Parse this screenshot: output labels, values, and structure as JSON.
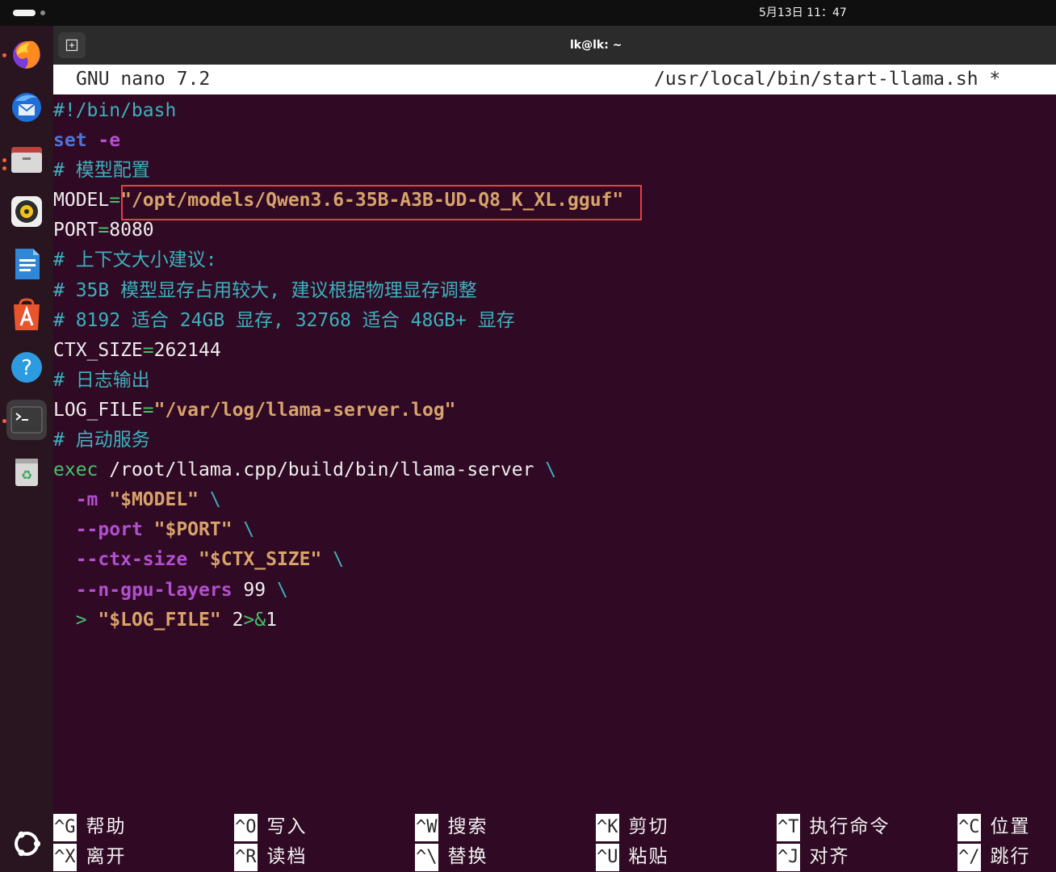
{
  "topbar": {
    "clock": "5月13日  11：47"
  },
  "window": {
    "title": "lk@lk: ~"
  },
  "nano": {
    "version": "GNU nano 7.2",
    "filename": "/usr/local/bin/start-llama.sh *"
  },
  "code": {
    "l1": "#!/bin/bash",
    "l2_kw": "set",
    "l2_flag": " -e",
    "l3": "# 模型配置",
    "l4_var": "MODEL",
    "l4_eq": "=",
    "l4_val": "\"/opt/models/Qwen3.6-35B-A3B-UD-Q8_K_XL.gguf\"",
    "l5_var": "PORT",
    "l5_eq": "=",
    "l5_val": "8080",
    "l6": "# 上下文大小建议:",
    "l7": "# 35B 模型显存占用较大, 建议根据物理显存调整",
    "l8": "# 8192 适合 24GB 显存, 32768 适合 48GB+ 显存",
    "l9_var": "CTX_SIZE",
    "l9_eq": "=",
    "l9_val": "262144",
    "l10": "# 日志输出",
    "l11_var": "LOG_FILE",
    "l11_eq": "=",
    "l11_val": "\"/var/log/llama-server.log\"",
    "l12": "# 启动服务",
    "l13_kw": "exec",
    "l13_path": " /root/llama.cpp/build/bin/llama-server ",
    "l13_bs": "\\",
    "l14_flag": "-m",
    "l14_val": " \"$MODEL\" ",
    "l14_bs": "\\",
    "l15_flag": "--port",
    "l15_val": " \"$PORT\" ",
    "l15_bs": "\\",
    "l16_flag": "--ctx-size",
    "l16_val": " \"$CTX_SIZE\" ",
    "l16_bs": "\\",
    "l17_flag": "--n-gpu-layers",
    "l17_val": " 99 ",
    "l17_bs": "\\",
    "l18_op": "> ",
    "l18_val": "\"$LOG_FILE\"",
    "l18_plain": " 2",
    "l18_op2": ">&",
    "l18_plain2": "1"
  },
  "shortcuts": [
    {
      "key": "^G",
      "label": "帮助"
    },
    {
      "key": "^O",
      "label": "写入"
    },
    {
      "key": "^W",
      "label": "搜索"
    },
    {
      "key": "^K",
      "label": "剪切"
    },
    {
      "key": "^T",
      "label": "执行命令"
    },
    {
      "key": "^C",
      "label": "位置"
    },
    {
      "key": "^X",
      "label": "离开"
    },
    {
      "key": "^R",
      "label": "读档"
    },
    {
      "key": "^\\",
      "label": "替换"
    },
    {
      "key": "^U",
      "label": "粘贴"
    },
    {
      "key": "^J",
      "label": "对齐"
    },
    {
      "key": "^/",
      "label": "跳行"
    }
  ],
  "dock": [
    "firefox-icon",
    "thunderbird-icon",
    "files-icon",
    "rhythmbox-icon",
    "writer-icon",
    "app-center-icon",
    "help-icon",
    "terminal-icon",
    "trash-icon",
    "ubuntu-logo-icon"
  ],
  "colors": {
    "accent": "#e64040",
    "terminal_bg": "#300a24",
    "comment": "#3db0bc",
    "string": "#d8a36a",
    "flag": "#b34fd1"
  }
}
